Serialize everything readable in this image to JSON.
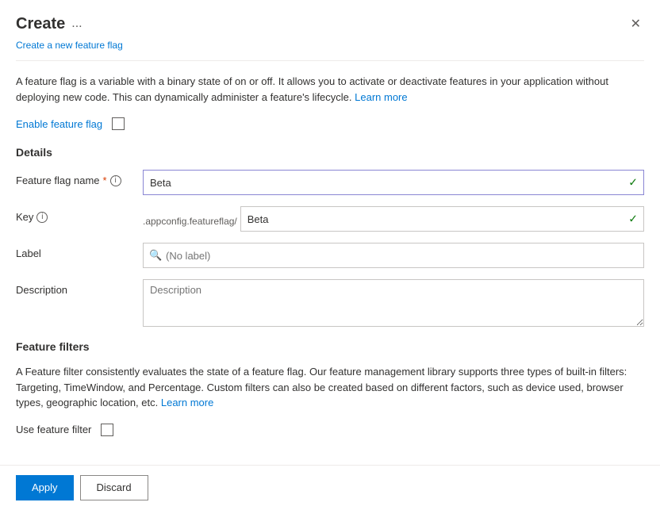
{
  "header": {
    "title": "Create",
    "more_label": "...",
    "subtitle": "Create a new feature flag",
    "close_icon": "✕"
  },
  "description": {
    "text1": "A feature flag is a variable with a binary state of on or off. It allows you to activate or deactivate features in your application without deploying new code. This can dynamically administer a feature's lifecycle.",
    "link_text": "Learn more"
  },
  "enable_flag": {
    "label": "Enable feature flag"
  },
  "details": {
    "section_title": "Details",
    "feature_flag_name_label": "Feature flag name",
    "required_indicator": "*",
    "feature_flag_name_value": "Beta",
    "key_label": "Key",
    "key_prefix": ".appconfig.featureflag/",
    "key_value": "Beta",
    "label_label": "Label",
    "label_placeholder": "(No label)",
    "description_label": "Description",
    "description_placeholder": "Description"
  },
  "feature_filters": {
    "section_title": "Feature filters",
    "description": "A Feature filter consistently evaluates the state of a feature flag. Our feature management library supports three types of built-in filters: Targeting, TimeWindow, and Percentage. Custom filters can also be created based on different factors, such as device used, browser types, geographic location, etc.",
    "link_text": "Learn more",
    "use_filter_label": "Use feature filter"
  },
  "footer": {
    "apply_label": "Apply",
    "discard_label": "Discard"
  }
}
